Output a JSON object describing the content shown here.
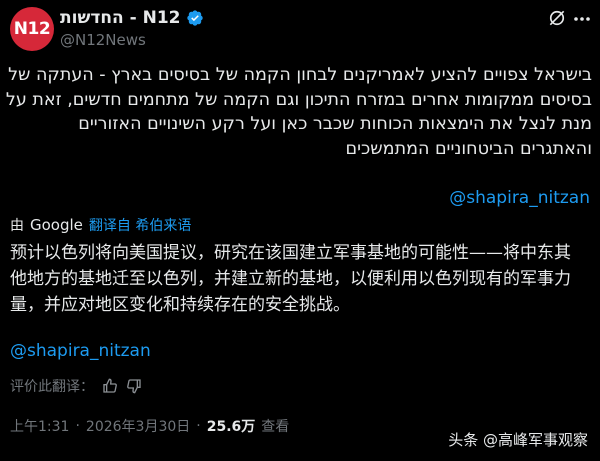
{
  "author": {
    "avatar_text": "N12",
    "display_name": "החדשות - N12",
    "handle": "@N12News"
  },
  "icons": {
    "verified": "verified-badge-icon",
    "grok": "grok-icon",
    "more": "more-options-icon",
    "thumbs_up": "thumbs-up-icon",
    "thumbs_down": "thumbs-down-icon"
  },
  "colors": {
    "background": "#000000",
    "text": "#e7e9ea",
    "link": "#1d9bf0",
    "muted": "#71767b",
    "avatar": "#d62839"
  },
  "tweet": {
    "hebrew_lines": [
      "בישראל צפויים להציע לאמריקנים לבחון הקמה של בסיסים בארץ - העתקה של",
      "בסיסים ממקומות אחרים במזרח התיכון וגם הקמה של מתחמים חדשים, זאת על",
      "מנת לנצל את הימצאות הכוחות שכבר כאן ועל רקע השינויים האזוריים",
      "והאתגרים הביטחוניים המתמשכים"
    ],
    "mention": "@shapira_nitzan"
  },
  "translation": {
    "by_label": "由",
    "provider": "Google",
    "link_text": "翻译自 希伯来语",
    "zh_lines": [
      "预计以色列将向美国提议，研究在该国建立军事基地的可能性——将中东其",
      "他地方的基地迁至以色列，并建立新的基地，以便利用以色列现有的军事力",
      "量，并应对地区变化和持续存在的安全挑战。"
    ],
    "mention": "@shapira_nitzan",
    "rate_label": "评价此翻译："
  },
  "meta": {
    "time": "上午1:31",
    "separator": "·",
    "date": "2026年3月30日",
    "views_count": "25.6万",
    "views_label": "查看"
  },
  "watermark": "头条 @高峰军事观察"
}
